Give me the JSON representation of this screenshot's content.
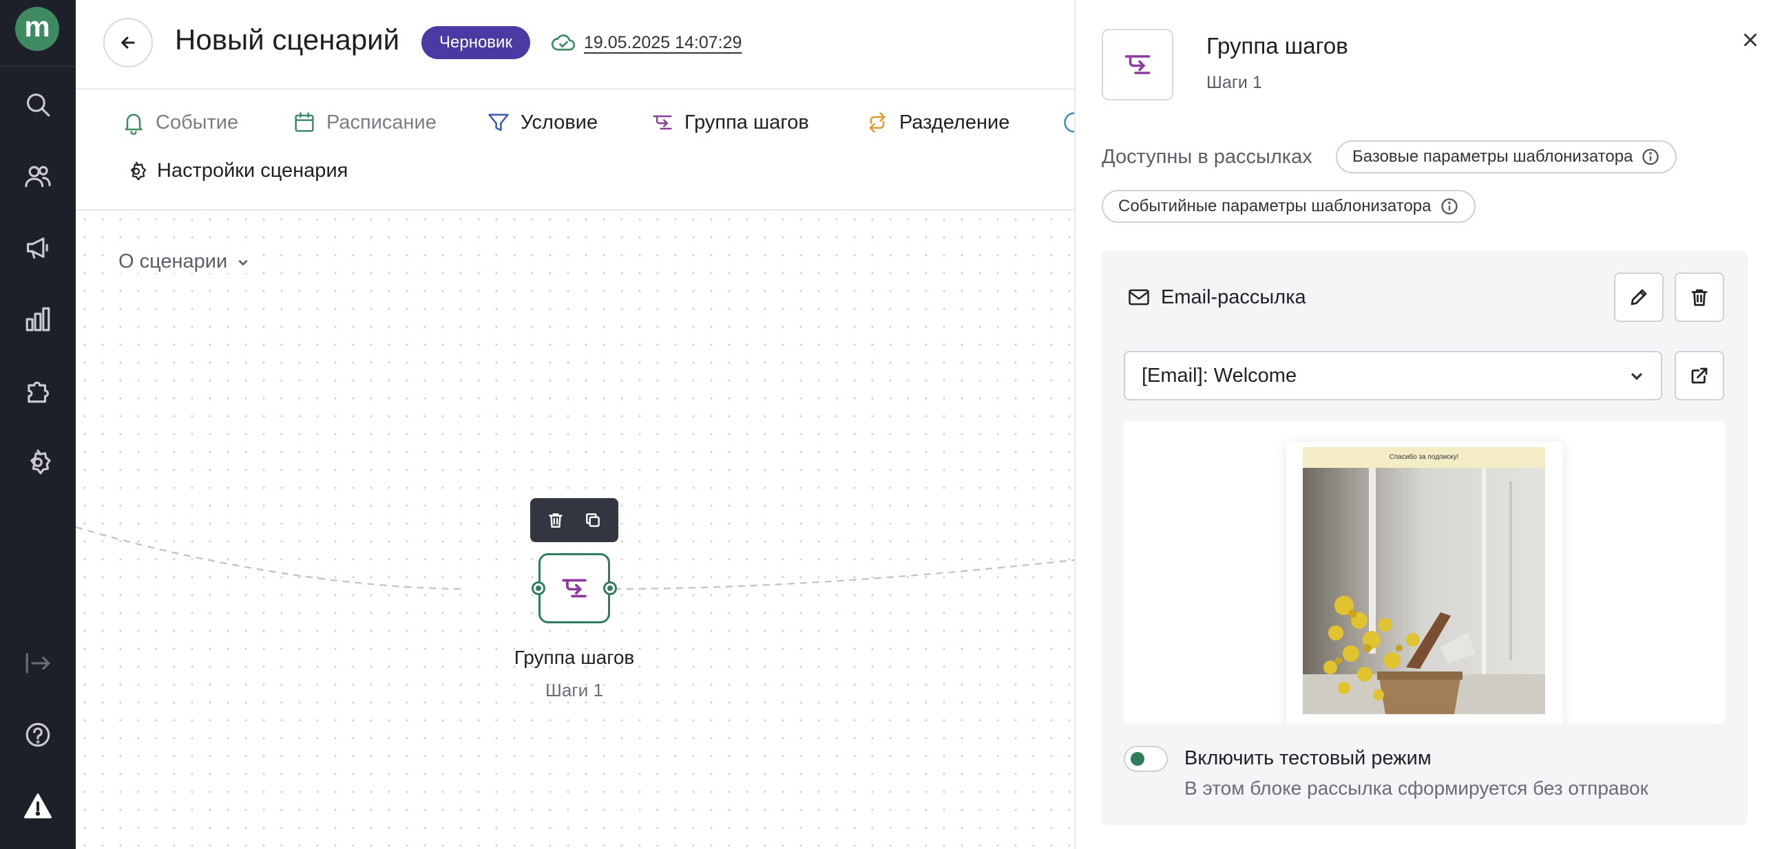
{
  "header": {
    "title": "Новый сценарий",
    "status_badge": "Черновик",
    "saved_at": "19.05.2025 14:07:29"
  },
  "toolbar": {
    "items": [
      {
        "label": "Событие",
        "icon": "bell-icon"
      },
      {
        "label": "Расписание",
        "icon": "calendar-icon"
      },
      {
        "label": "Условие",
        "icon": "filter-icon"
      },
      {
        "label": "Группа шагов",
        "icon": "step-group-icon"
      },
      {
        "label": "Разделение",
        "icon": "split-icon"
      }
    ],
    "settings_label": "Настройки сценария"
  },
  "canvas": {
    "about_label": "О сценарии",
    "node": {
      "title": "Группа шагов",
      "subtitle": "Шаги 1"
    }
  },
  "panel": {
    "title": "Группа шагов",
    "subtitle": "Шаги 1",
    "available_label": "Доступны в рассылках",
    "chips": [
      "Базовые параметры шаблонизатора",
      "Событийные параметры шаблонизатора"
    ],
    "card": {
      "title": "Email-рассылка",
      "selected_template": "[Email]: Welcome",
      "preview_banner": "Спасибо за подписку!",
      "test_mode_label": "Включить тестовый режим",
      "test_mode_hint": "В этом блоке рассылка сформируется без отправок",
      "test_mode_on": false
    }
  },
  "sidebar": {
    "logo": "m",
    "icons": [
      "search-icon",
      "users-icon",
      "megaphone-icon",
      "chart-icon",
      "puzzle-icon",
      "gear-icon",
      "collapse-icon",
      "help-icon",
      "warning-icon"
    ]
  },
  "colors": {
    "sidebar_bg": "#1e2029",
    "brand_green": "#3d8a63",
    "badge_purple": "#4a3aa4",
    "step_group_purple": "#8e3aa0",
    "node_border": "#2f7d5a"
  }
}
